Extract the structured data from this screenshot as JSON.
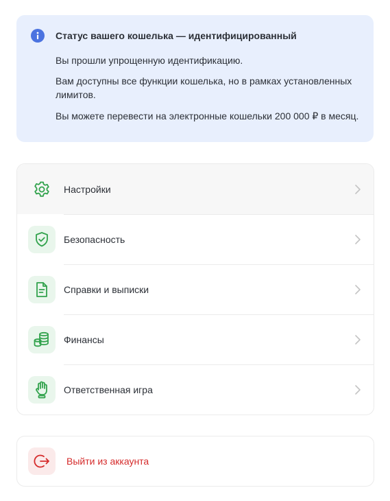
{
  "status": {
    "icon": "info-icon",
    "title": "Статус вашего кошелька — идентифицированный",
    "line1": "Вы прошли упрощенную идентификацию.",
    "line2": "Вам доступны все функции кошелька, но в рамках установленных лимитов.",
    "line3": "Вы можете перевести на электронные кошельки 200 000 ₽ в месяц."
  },
  "menu": {
    "items": [
      {
        "label": "Настройки",
        "icon": "gear-icon"
      },
      {
        "label": "Безопасность",
        "icon": "shield-check-icon"
      },
      {
        "label": "Справки и выписки",
        "icon": "document-icon"
      },
      {
        "label": "Финансы",
        "icon": "coins-icon"
      },
      {
        "label": "Ответственная игра",
        "icon": "hand-icon"
      }
    ]
  },
  "logout": {
    "label": "Выйти из аккаунта",
    "icon": "logout-icon"
  },
  "colors": {
    "info_bg": "#e8effd",
    "info_icon": "#4b73e0",
    "accent_green": "#31a24c",
    "danger_red": "#d52b2b"
  }
}
